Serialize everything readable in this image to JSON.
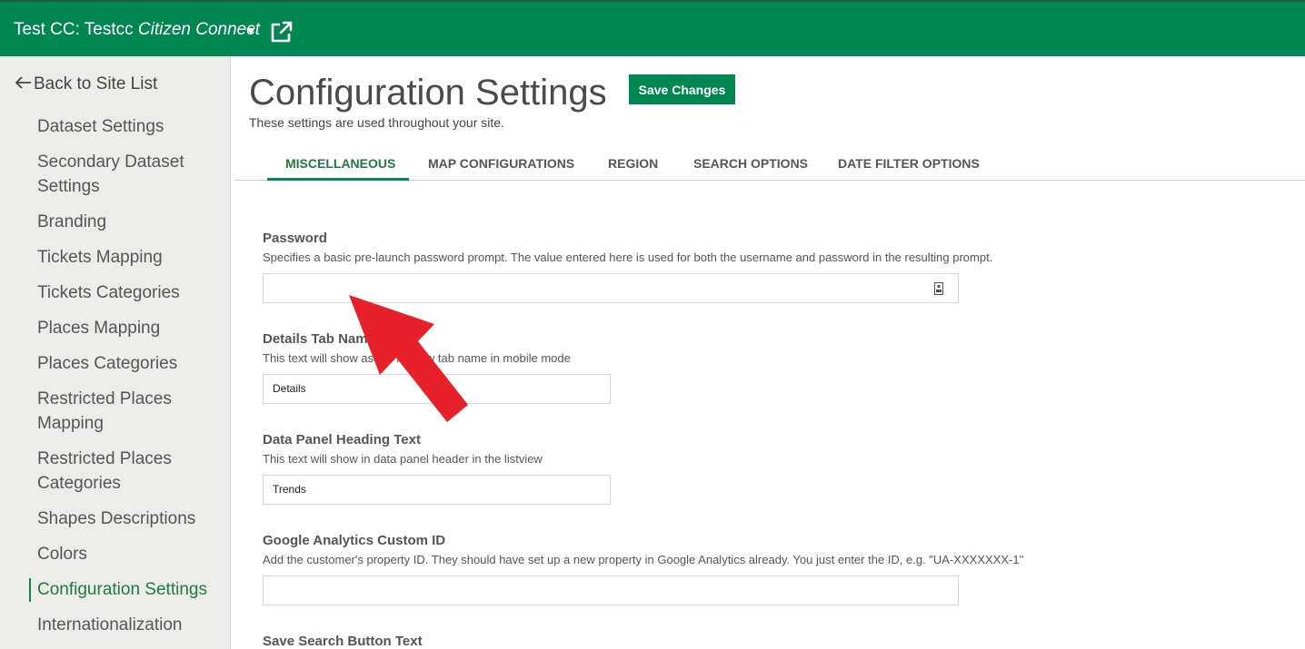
{
  "header": {
    "site_prefix": "Test CC: Testcc ",
    "site_name": "Citizen Connect",
    "dropdown_icon": "caret-down-icon",
    "external_link_icon": "external-link-icon",
    "bg_color": "#008751"
  },
  "sidebar": {
    "back_label": "Back to Site List",
    "items": [
      {
        "label": "Dataset Settings"
      },
      {
        "label": "Secondary Dataset Settings"
      },
      {
        "label": "Branding"
      },
      {
        "label": "Tickets Mapping"
      },
      {
        "label": "Tickets Categories"
      },
      {
        "label": "Places Mapping"
      },
      {
        "label": "Places Categories"
      },
      {
        "label": "Restricted Places Mapping"
      },
      {
        "label": "Restricted Places Categories"
      },
      {
        "label": "Shapes Descriptions"
      },
      {
        "label": "Colors"
      },
      {
        "label": "Configuration Settings"
      },
      {
        "label": "Internationalization"
      }
    ],
    "active_item": "Configuration Settings"
  },
  "page": {
    "title": "Configuration Settings",
    "save_label": "Save Changes",
    "subtitle": "These settings are used throughout your site."
  },
  "tabs": [
    {
      "label": "MISCELLANEOUS"
    },
    {
      "label": "MAP CONFIGURATIONS"
    },
    {
      "label": "REGION"
    },
    {
      "label": "SEARCH OPTIONS"
    },
    {
      "label": "DATE FILTER OPTIONS"
    }
  ],
  "active_tab": "MISCELLANEOUS",
  "fields": {
    "password": {
      "label": "Password",
      "help": "Specifies a basic pre-launch password prompt. The value entered here is used for both the username and password in the resulting prompt.",
      "value": ""
    },
    "details_tab": {
      "label": "Details Tab Name",
      "help": "This text will show as the listview tab name in mobile mode",
      "value": "Details"
    },
    "data_panel": {
      "label": "Data Panel Heading Text",
      "help": "This text will show in data panel header in the listview",
      "value": "Trends"
    },
    "ga_id": {
      "label": "Google Analytics Custom ID",
      "help": "Add the customer's property ID. They should have set up a new property in Google Analytics already. You just enter the ID, e.g. \"UA-XXXXXXX-1\"",
      "value": ""
    },
    "save_search": {
      "label": "Save Search Button Text"
    }
  },
  "colors": {
    "accent": "#008751",
    "annotation_arrow": "#e8202a"
  }
}
